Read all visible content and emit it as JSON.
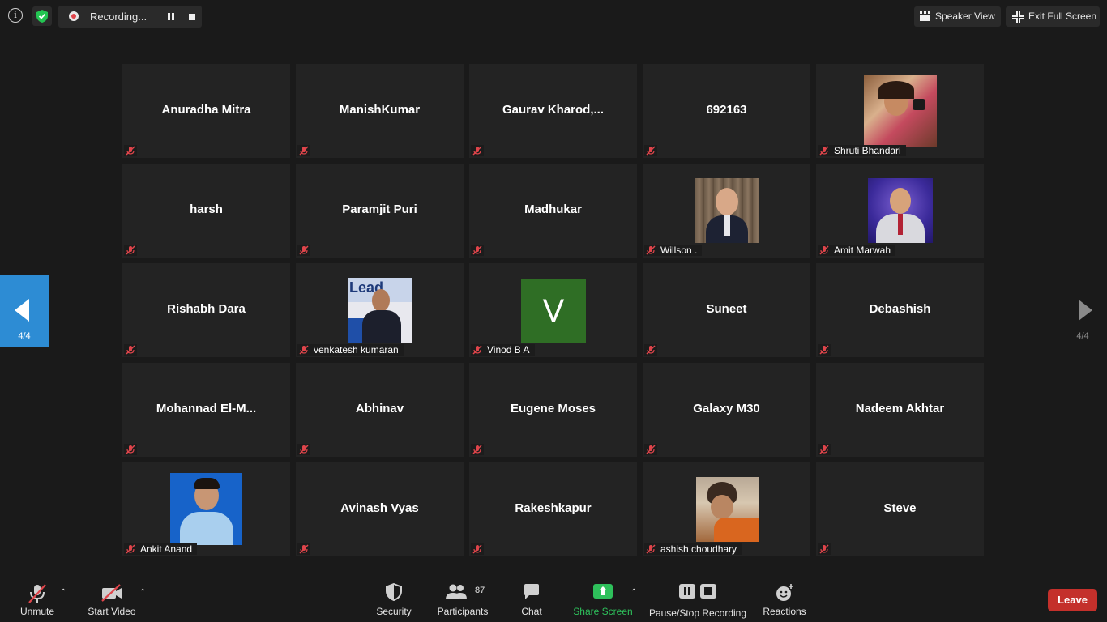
{
  "topbar": {
    "info_icon": "info-icon",
    "security_icon": "shield-check-icon",
    "recording_label": "Recording...",
    "speaker_view_label": "Speaker View",
    "exit_full_screen_label": "Exit Full Screen"
  },
  "gallery": {
    "page_indicator_prev": "4/4",
    "page_indicator_next": "4/4",
    "tiles": [
      {
        "name": "Anuradha Mitra",
        "muted": true
      },
      {
        "name": "ManishKumar",
        "muted": true
      },
      {
        "name": "Gaurav  Kharod,...",
        "muted": true
      },
      {
        "name": "692163",
        "muted": true
      },
      {
        "name": "Shruti Bhandari",
        "muted": true,
        "has_photo": true
      },
      {
        "name": "harsh",
        "muted": true
      },
      {
        "name": "Paramjit Puri",
        "muted": true
      },
      {
        "name": "Madhukar",
        "muted": true
      },
      {
        "name": "Willson .",
        "muted": true,
        "has_photo": true
      },
      {
        "name": "Amit Marwah",
        "muted": true,
        "has_photo": true
      },
      {
        "name": "Rishabh Dara",
        "muted": true
      },
      {
        "name": "venkatesh kumaran",
        "muted": true,
        "has_photo": true
      },
      {
        "name": "Vinod B A",
        "muted": true,
        "avatar_letter": "V"
      },
      {
        "name": "Suneet",
        "muted": true
      },
      {
        "name": "Debashish",
        "muted": true
      },
      {
        "name": "Mohannad  El-M...",
        "muted": true
      },
      {
        "name": "Abhinav",
        "muted": true
      },
      {
        "name": "Eugene Moses",
        "muted": true
      },
      {
        "name": "Galaxy M30",
        "muted": true
      },
      {
        "name": "Nadeem Akhtar",
        "muted": true
      },
      {
        "name": "Ankit Anand",
        "muted": true,
        "has_photo": true
      },
      {
        "name": "Avinash Vyas",
        "muted": true
      },
      {
        "name": "Rakeshkapur",
        "muted": true
      },
      {
        "name": "ashish choudhary",
        "muted": true,
        "has_photo": true
      },
      {
        "name": "Steve",
        "muted": true
      }
    ],
    "photo_text": "Lead"
  },
  "toolbar": {
    "unmute_label": "Unmute",
    "start_video_label": "Start Video",
    "security_label": "Security",
    "participants_label": "Participants",
    "participants_count": "87",
    "chat_label": "Chat",
    "share_screen_label": "Share Screen",
    "pause_stop_label": "Pause/Stop Recording",
    "reactions_label": "Reactions",
    "leave_label": "Leave"
  },
  "colors": {
    "background": "#1a1a1a",
    "tile": "#232323",
    "accent_blue": "#2d8cd4",
    "share_green": "#2ec05b",
    "leave_red": "#c4302b",
    "mute_red": "#e0454b",
    "avatar_green": "#2f6e25"
  }
}
